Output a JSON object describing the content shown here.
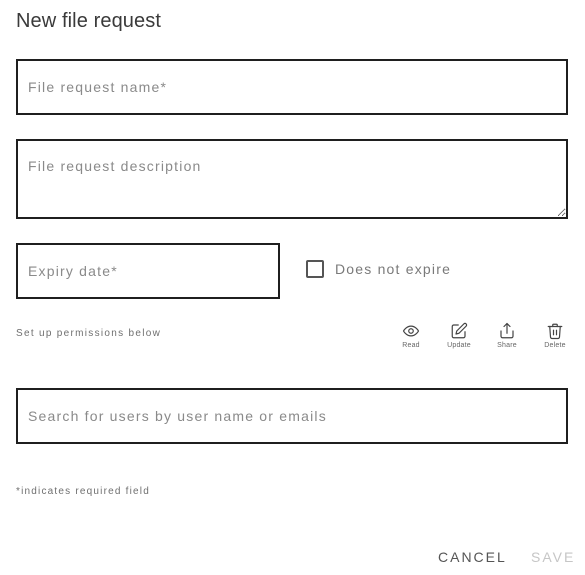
{
  "dialog": {
    "title": "New file request"
  },
  "form": {
    "name_placeholder": "File request name*",
    "description_placeholder": "File request description",
    "expiry_placeholder": "Expiry date*",
    "no_expire_label": "Does not expire",
    "no_expire_checked": false,
    "permissions_label": "Set up permissions below",
    "search_placeholder": "Search for users by user name or emails",
    "required_note": "*indicates required field"
  },
  "permissions": {
    "read": {
      "label": "Read",
      "icon": "eye-icon"
    },
    "update": {
      "label": "Update",
      "icon": "edit-icon"
    },
    "share": {
      "label": "Share",
      "icon": "share-icon"
    },
    "delete": {
      "label": "Delete",
      "icon": "trash-icon"
    }
  },
  "actions": {
    "cancel_label": "CANCEL",
    "save_label": "SAVE"
  }
}
